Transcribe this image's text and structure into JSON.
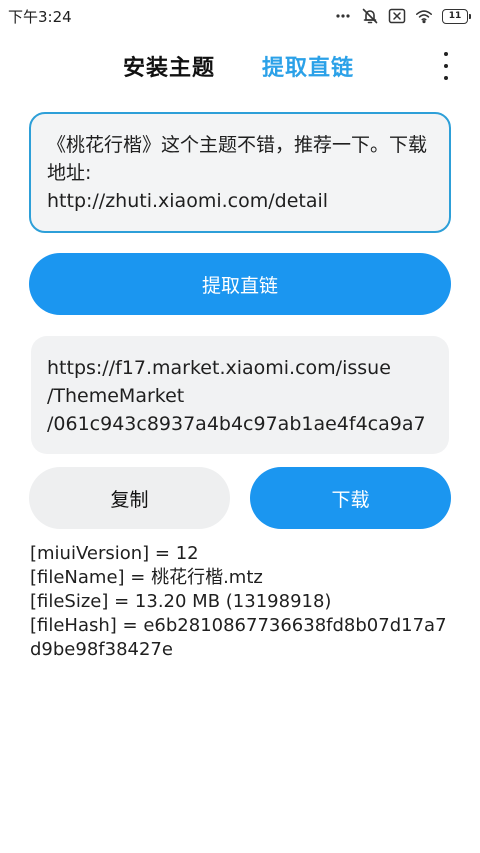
{
  "status_bar": {
    "time": "下午3:24",
    "battery_level": "11",
    "icons": [
      "more-dots-icon",
      "alarm-off-icon",
      "sim-off-icon",
      "wifi-icon",
      "battery-icon"
    ]
  },
  "header": {
    "tabs": [
      {
        "label": "安装主题",
        "active": false
      },
      {
        "label": "提取直链",
        "active": true
      }
    ],
    "accent_color": "#2ba1e8",
    "more_icon": "more-vertical-icon"
  },
  "input": {
    "value": "《桃花行楷》这个主题不错，推荐一下。下载地址:\nhttp://zhuti.xiaomi.com/detail"
  },
  "extract_button": {
    "label": "提取直链",
    "color": "#1b96f0"
  },
  "result": {
    "url": "https://f17.market.xiaomi.com/issue\n/ThemeMarket\n/061c943c8937a4b4c97ab1ae4f4ca9a7"
  },
  "actions": {
    "copy_label": "复制",
    "download_label": "下载"
  },
  "info": {
    "lines": [
      "[miuiVersion] = 12",
      "[fileName] = 桃花行楷.mtz",
      "[fileSize] = 13.20 MB (13198918)",
      "[fileHash] = e6b2810867736638fd8b07d17a7\nd9be98f38427e"
    ]
  }
}
